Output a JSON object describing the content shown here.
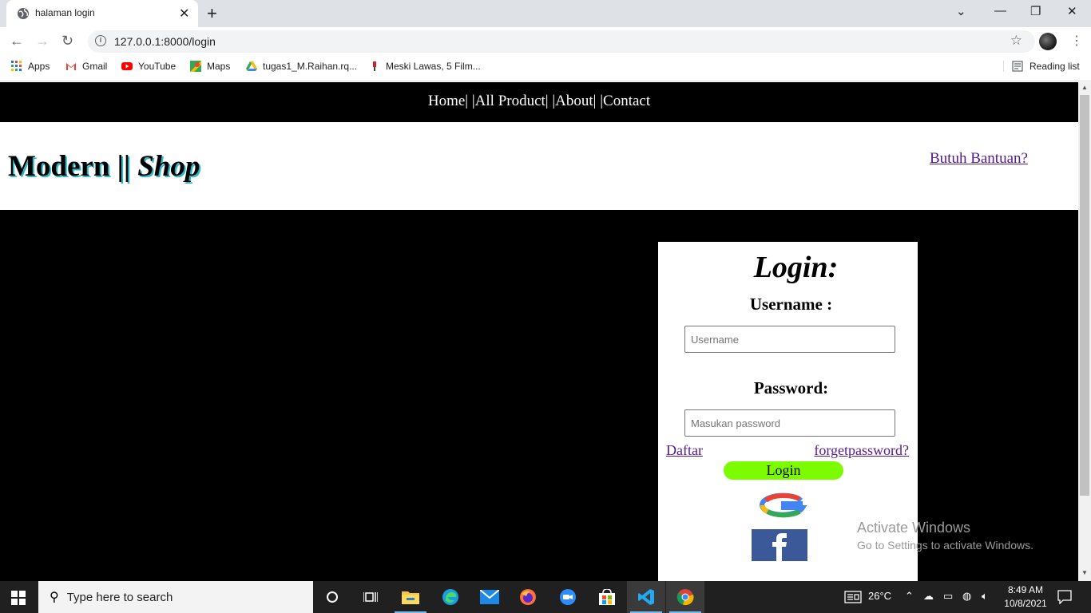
{
  "browser": {
    "tab_title": "halaman login",
    "url": "127.0.0.1:8000/login",
    "bookmarks": [
      "Apps",
      "Gmail",
      "YouTube",
      "Maps",
      "tugas1_M.Raihan.rq...",
      "Meski Lawas, 5 Film..."
    ],
    "reading_list": "Reading list"
  },
  "page": {
    "nav": [
      "Home|",
      "|All Product|",
      "|About|",
      "|Contact"
    ],
    "logo": {
      "main": "Modern || ",
      "italic": "Shop"
    },
    "help_link": "Butuh Bantuan?",
    "login": {
      "title": "Login:",
      "username_label": "Username :",
      "username_placeholder": "Username",
      "password_label": "Password:",
      "password_placeholder": "Masukan password",
      "register_link": "Daftar",
      "forgot_link": "forgetpassword?",
      "button": "Login"
    }
  },
  "watermark": {
    "line1": "Activate Windows",
    "line2": "Go to Settings to activate Windows."
  },
  "taskbar": {
    "search_placeholder": "Type here to search",
    "weather": "26°C",
    "time": "8:49 AM",
    "date": "10/8/2021"
  },
  "colors": {
    "login_button": "#7cfc00",
    "logo_shadow": "#29b6c5",
    "facebook": "#3b5998"
  }
}
